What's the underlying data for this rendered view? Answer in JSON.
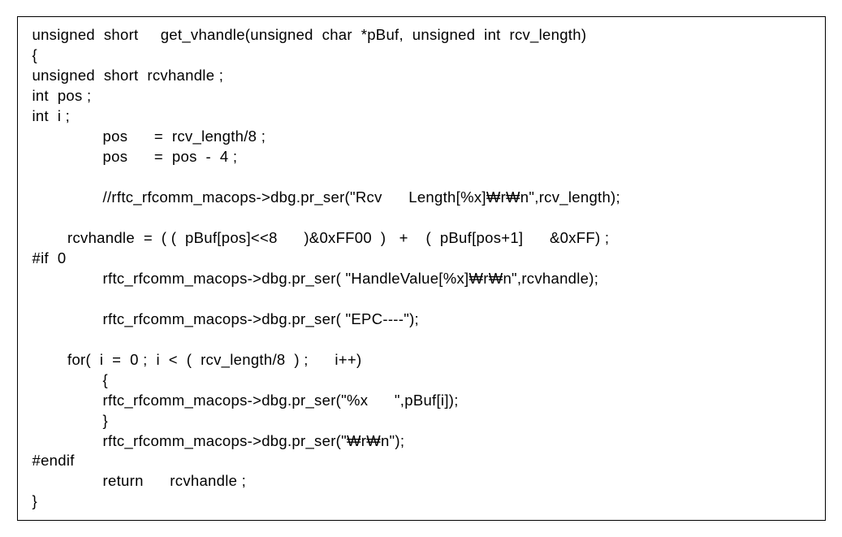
{
  "code": {
    "lines": [
      "unsigned  short     get_vhandle(unsigned  char  *pBuf,  unsigned  int  rcv_length)",
      "{",
      "unsigned  short  rcvhandle ;",
      "int  pos ;",
      "int  i ;",
      "                pos      =  rcv_length/8 ;",
      "                pos      =  pos  -  4 ;",
      "",
      "                //rftc_rfcomm_macops->dbg.pr_ser(\"Rcv      Length[%x]₩r₩n\",rcv_length);",
      "",
      "        rcvhandle  =  ( (  pBuf[pos]<<8      )&0xFF00  )   +    (  pBuf[pos+1]      &0xFF) ;",
      "#if  0",
      "                rftc_rfcomm_macops->dbg.pr_ser( \"HandleValue[%x]₩r₩n\",rcvhandle);",
      "",
      "                rftc_rfcomm_macops->dbg.pr_ser( \"EPC----\");",
      "",
      "        for(  i  =  0 ;  i  <  (  rcv_length/8  ) ;      i++)",
      "                {",
      "                rftc_rfcomm_macops->dbg.pr_ser(\"%x      \",pBuf[i]);",
      "                }",
      "                rftc_rfcomm_macops->dbg.pr_ser(\"₩r₩n\");",
      "#endif",
      "                return      rcvhandle ;",
      "}"
    ]
  }
}
